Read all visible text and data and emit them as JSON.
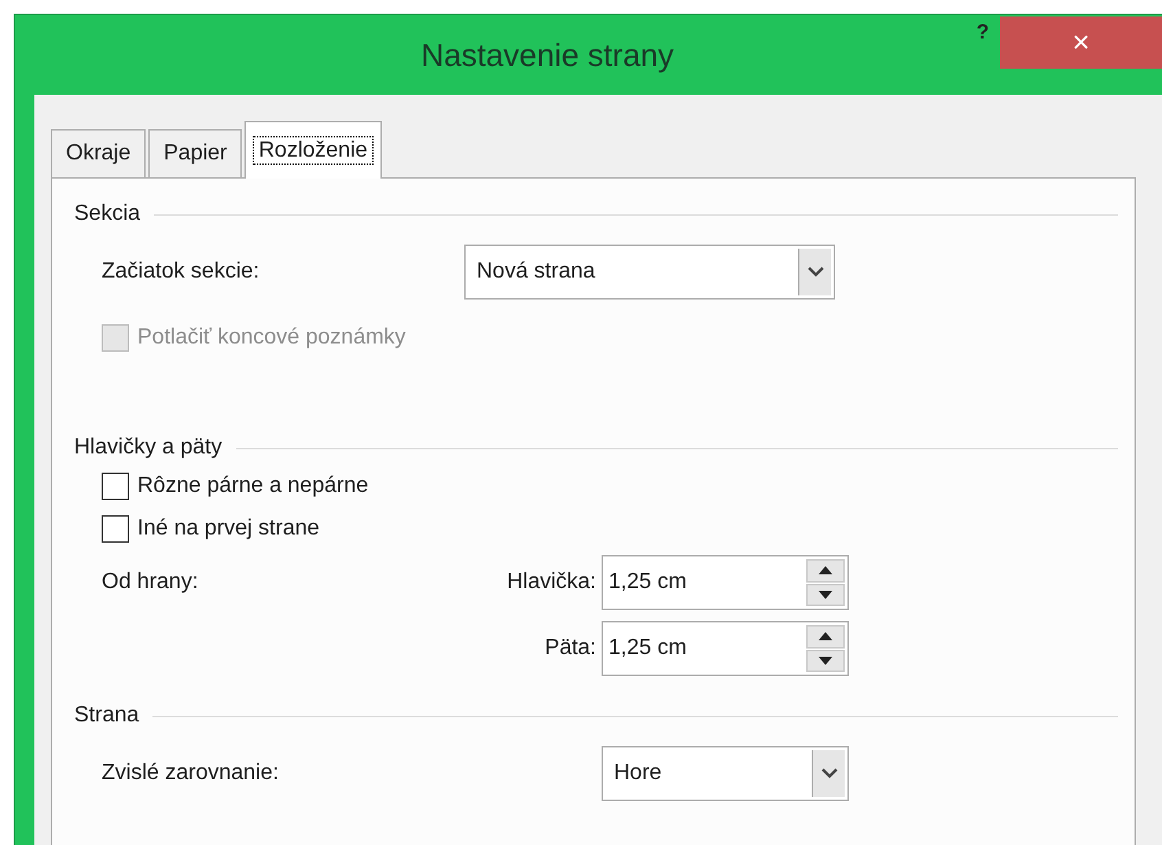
{
  "window": {
    "title": "Nastavenie strany",
    "help": "?",
    "close": "×"
  },
  "tabs": [
    {
      "label": "Okraje",
      "selected": false
    },
    {
      "label": "Papier",
      "selected": false
    },
    {
      "label": "Rozloženie",
      "selected": true
    }
  ],
  "sections": [
    {
      "title": "Sekcia",
      "items": [
        {
          "kind": "select",
          "label": "Začiatok sekcie:",
          "value": "Nová strana"
        },
        {
          "kind": "checkbox",
          "label": "Potlačiť koncové poznámky",
          "checked": false,
          "disabled": true
        }
      ]
    },
    {
      "title": "Hlavičky a päty",
      "items": [
        {
          "kind": "checkbox",
          "label": "Rôzne párne a nepárne",
          "checked": false,
          "disabled": false
        },
        {
          "kind": "checkbox",
          "label": "Iné na prvej strane",
          "checked": false,
          "disabled": false
        },
        {
          "kind": "spinner",
          "caption": "Od hrany:",
          "label": "Hlavička:",
          "value": "1,25 cm"
        },
        {
          "kind": "spinner",
          "label": "Päta:",
          "value": "1,25 cm"
        }
      ]
    },
    {
      "title": "Strana",
      "items": [
        {
          "kind": "select",
          "label": "Zvislé zarovnanie:",
          "value": "Hore"
        }
      ]
    }
  ]
}
